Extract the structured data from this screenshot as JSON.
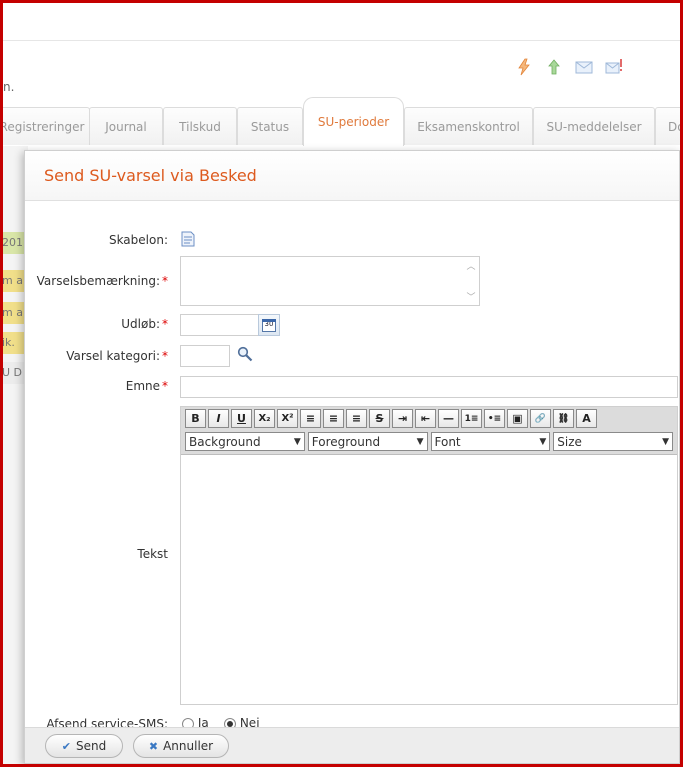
{
  "background": {
    "period_fragment": "n.",
    "tabs": [
      {
        "label": "Registreringer"
      },
      {
        "label": "Journal"
      },
      {
        "label": "Tilskud"
      },
      {
        "label": "Status"
      },
      {
        "label": "SU-perioder"
      },
      {
        "label": "Eksamenskontrol"
      },
      {
        "label": "SU-meddelelser"
      },
      {
        "label": "Do"
      }
    ],
    "strip_cells": [
      "201",
      "m a",
      "m a",
      "ik.",
      "U D"
    ]
  },
  "dialog": {
    "title": "Send SU-varsel via Besked",
    "fields": {
      "skabelon_label": "Skabelon:",
      "varsel_label": "Varselsbemærkning:",
      "udlob_label": "Udløb:",
      "kategori_label": "Varsel kategori:",
      "emne_label": "Emne",
      "tekst_label": "Tekst",
      "sms_label": "Afsend service-SMS:",
      "required_mark": "*"
    },
    "editor": {
      "buttons": [
        "B",
        "I",
        "U",
        "X₂",
        "X²",
        "≡",
        "≡",
        "≡",
        "S",
        "⇥",
        "⇤",
        "—",
        "1≡",
        "•≡",
        "▣",
        "🔗",
        "⛓",
        "A"
      ],
      "selects": [
        "Background",
        "Foreground",
        "Font",
        "Size"
      ]
    },
    "sms_options": [
      {
        "label": "Ja",
        "checked": false
      },
      {
        "label": "Nej",
        "checked": true
      }
    ],
    "buttons": {
      "send": "Send",
      "cancel": "Annuller"
    }
  }
}
